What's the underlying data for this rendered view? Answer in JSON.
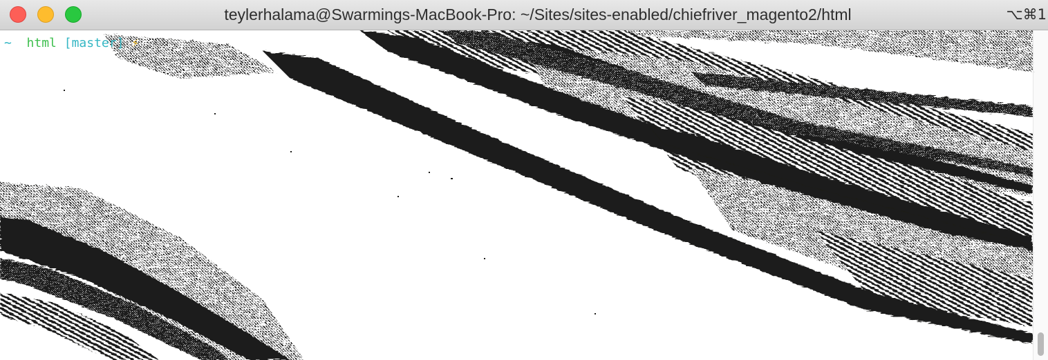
{
  "window": {
    "title": "teylerhalama@Swarmings-MacBook-Pro: ~/Sites/sites-enabled/chiefriver_magento2/html",
    "shortcut": "⌥⌘1"
  },
  "prompt": {
    "tilde": "~",
    "directory": "html",
    "branch": "[master]",
    "status_icon": "⚡"
  },
  "background": {
    "description_icon": "bw-dithered-canyon-strata",
    "ink_color": "#1c1c1a",
    "paper_color": "#ffffff"
  },
  "scrollbar": {
    "position_fraction": 1.0
  }
}
